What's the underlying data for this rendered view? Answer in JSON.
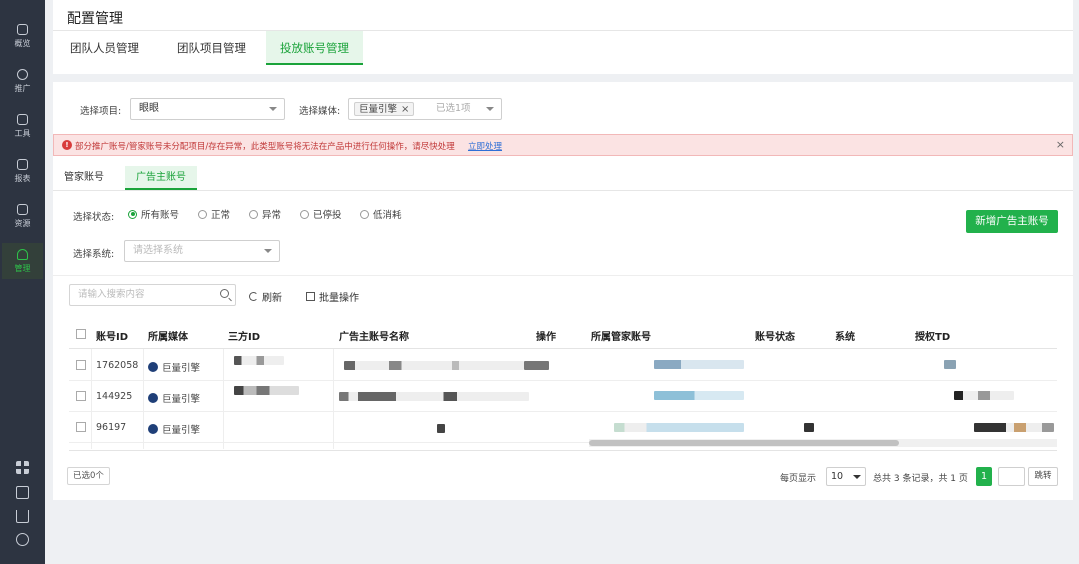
{
  "sidebar": {
    "items": [
      {
        "label": "概览",
        "icon": "overview-icon"
      },
      {
        "label": "推广",
        "icon": "promotion-icon"
      },
      {
        "label": "工具",
        "icon": "tools-icon"
      },
      {
        "label": "报表",
        "icon": "report-icon"
      },
      {
        "label": "资源",
        "icon": "resource-icon"
      },
      {
        "label": "管理",
        "icon": "manage-icon"
      }
    ],
    "active_index": 5,
    "bottom_icons": [
      "qrcode-icon",
      "screen-icon",
      "download-icon",
      "user-circle-icon"
    ]
  },
  "header": {
    "title": "配置管理",
    "tabs": [
      "团队人员管理",
      "团队项目管理",
      "投放账号管理"
    ],
    "active_tab": 2
  },
  "filters": {
    "project_label": "选择项目:",
    "project_value": "眼眼",
    "media_label": "选择媒体:",
    "media_tag": "巨量引擎",
    "media_selected_count": "已选1项"
  },
  "alert": {
    "text": "部分推广账号/管家账号未分配项目/存在异常，此类型账号将无法在产品中进行任何操作，请尽快处理",
    "link": "立即处理",
    "close": "×"
  },
  "sub_tabs": [
    "管家账号",
    "广告主账号"
  ],
  "active_sub_tab": 1,
  "status_filter": {
    "label": "选择状态:",
    "options": [
      "所有账号",
      "正常",
      "异常",
      "已停投",
      "低消耗"
    ],
    "selected": 0
  },
  "system_filter": {
    "label": "选择系统:",
    "placeholder": "请选择系统"
  },
  "add_button": "新增广告主账号",
  "toolbar": {
    "search_placeholder": "请输入搜索内容",
    "refresh": "刷新",
    "batch": "批量操作"
  },
  "table": {
    "columns": [
      "账号ID",
      "所属媒体",
      "三方ID",
      "广告主账号名称",
      "操作",
      "所属管家账号",
      "账号状态",
      "系统",
      "授权TD"
    ],
    "rows": [
      {
        "id": "1762058",
        "media": "巨量引擎"
      },
      {
        "id": "144925",
        "media": "巨量引擎"
      },
      {
        "id": "96197",
        "media": "巨量引擎"
      }
    ]
  },
  "footer": {
    "selected": "已选0个",
    "per_page_label": "每页显示",
    "per_page": "10",
    "total": "总共 3 条记录，共 1 页",
    "current_page": "1",
    "jump": "跳转"
  }
}
